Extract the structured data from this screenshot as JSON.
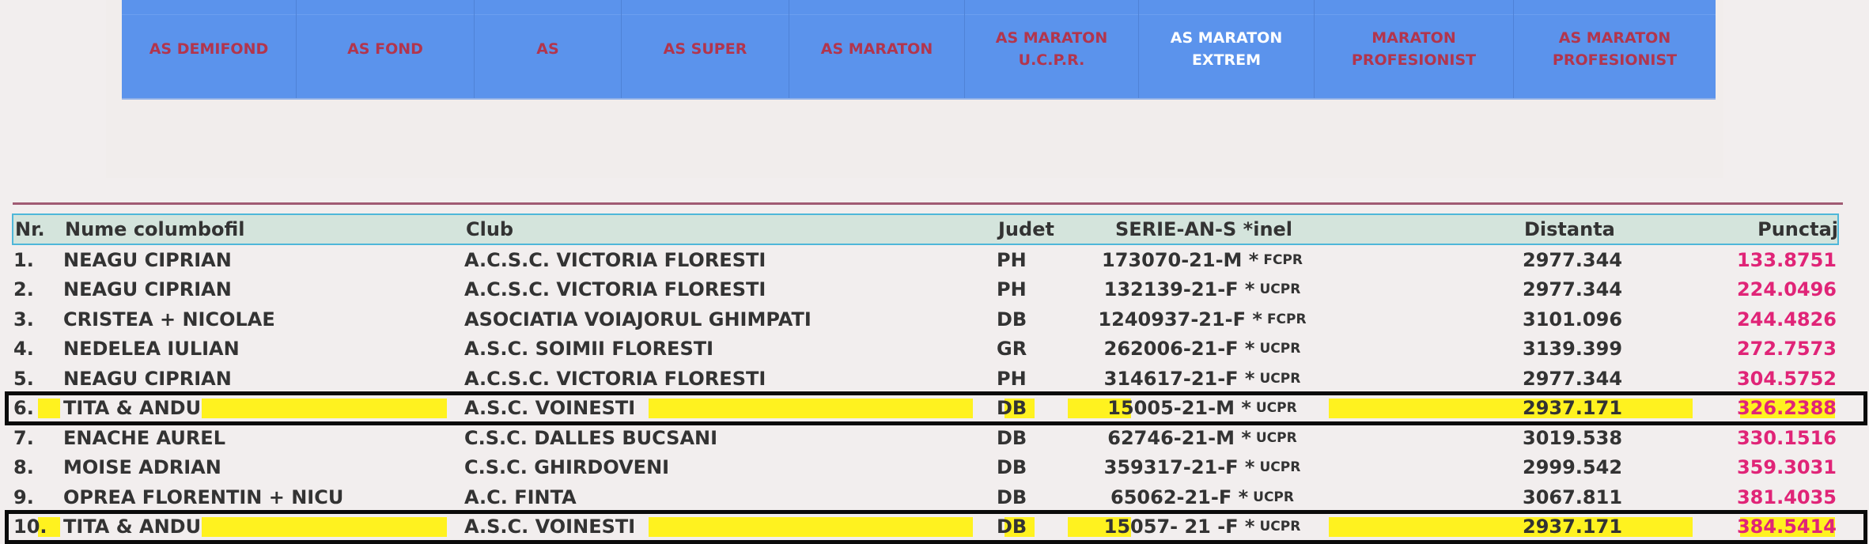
{
  "nav": {
    "tabs": [
      {
        "label": "AS DEMIFOND",
        "active": false
      },
      {
        "label": "AS FOND",
        "active": false
      },
      {
        "label": "AS",
        "active": false
      },
      {
        "label": "AS SUPER",
        "active": false
      },
      {
        "label": "AS MARATON",
        "active": false
      },
      {
        "label": "AS MARATON\nU.C.P.R.",
        "active": false
      },
      {
        "label": "AS MARATON\nEXTREM",
        "active": true
      },
      {
        "label": "MARATON\nPROFESIONIST",
        "active": false
      },
      {
        "label": "AS MARATON\nPROFESIONIST",
        "active": false
      }
    ]
  },
  "table": {
    "headers": {
      "nr": "Nr.",
      "name": "Nume columbofil",
      "club": "Club",
      "judet": "Judet",
      "serie": "SERIE-AN-S *inel",
      "distanta": "Distanta",
      "punctaj": "Punctaj"
    },
    "rows": [
      {
        "nr": "1.",
        "name": "NEAGU CIPRIAN",
        "club": "A.C.S.C. VICTORIA FLORESTI",
        "judet": "PH",
        "serie": "173070-21-M *",
        "ring": "FCPR",
        "distanta": "2977.344",
        "punctaj": "133.8751"
      },
      {
        "nr": "2.",
        "name": "NEAGU CIPRIAN",
        "club": "A.C.S.C. VICTORIA FLORESTI",
        "judet": "PH",
        "serie": "132139-21-F *",
        "ring": "UCPR",
        "distanta": "2977.344",
        "punctaj": "224.0496"
      },
      {
        "nr": "3.",
        "name": "CRISTEA + NICOLAE",
        "club": "ASOCIATIA VOIAJORUL GHIMPATI",
        "judet": "DB",
        "serie": "1240937-21-F *",
        "ring": "FCPR",
        "distanta": "3101.096",
        "punctaj": "244.4826"
      },
      {
        "nr": "4.",
        "name": "NEDELEA IULIAN",
        "club": "A.S.C. SOIMII FLORESTI",
        "judet": "GR",
        "serie": "262006-21-F *",
        "ring": "UCPR",
        "distanta": "3139.399",
        "punctaj": "272.7573"
      },
      {
        "nr": "5.",
        "name": "NEAGU CIPRIAN",
        "club": "A.C.S.C. VICTORIA FLORESTI",
        "judet": "PH",
        "serie": "314617-21-F *",
        "ring": "UCPR",
        "distanta": "2977.344",
        "punctaj": "304.5752"
      },
      {
        "nr": "6.",
        "name": "TITA & ANDU",
        "club": "A.S.C. VOINESTI",
        "judet": "DB",
        "serie": "15005-21-M *",
        "ring": "UCPR",
        "distanta": "2937.171",
        "punctaj": "326.2388"
      },
      {
        "nr": "7.",
        "name": "ENACHE AUREL",
        "club": "C.S.C. DALLES BUCSANI",
        "judet": "DB",
        "serie": "62746-21-M *",
        "ring": "UCPR",
        "distanta": "3019.538",
        "punctaj": "330.1516"
      },
      {
        "nr": "8.",
        "name": "MOISE ADRIAN",
        "club": "C.S.C. GHIRDOVENI",
        "judet": "DB",
        "serie": "359317-21-F *",
        "ring": "UCPR",
        "distanta": "2999.542",
        "punctaj": "359.3031"
      },
      {
        "nr": "9.",
        "name": "OPREA FLORENTIN + NICU",
        "club": "A.C. FINTA",
        "judet": "DB",
        "serie": "65062-21-F *",
        "ring": "UCPR",
        "distanta": "3067.811",
        "punctaj": "381.4035"
      },
      {
        "nr": "10.",
        "name": "TITA & ANDU",
        "club": "A.S.C. VOINESTI",
        "judet": "DB",
        "serie": "15057- 21 -F *",
        "ring": "UCPR",
        "distanta": "2937.171",
        "punctaj": "384.5414"
      }
    ]
  },
  "colors": {
    "nav_bg": "#5b93ec",
    "nav_text": "#b2354d",
    "nav_active_text": "#ffffff",
    "score_text": "#e02477",
    "highlight": "#fff21f",
    "header_bg": "#d4e4dc",
    "header_border": "#4fb7d9"
  }
}
